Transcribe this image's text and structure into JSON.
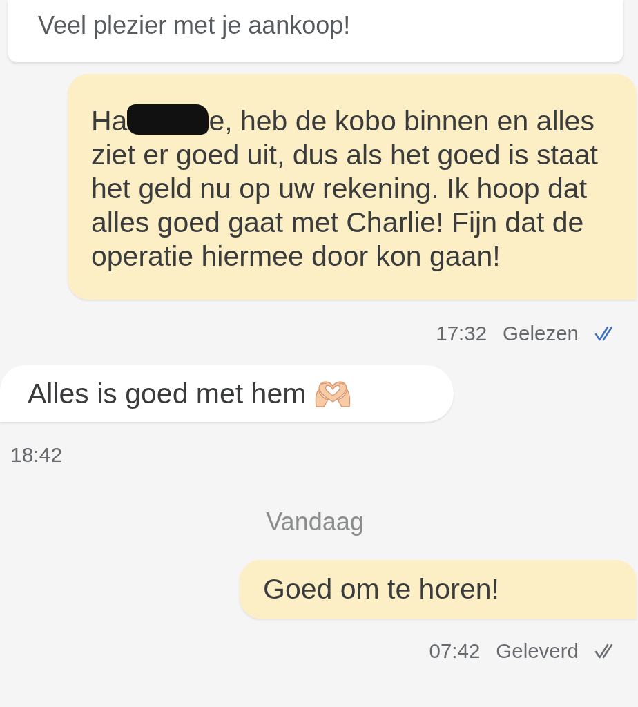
{
  "messages": [
    {
      "kind": "card",
      "text": "Veel plezier met je aankoop!"
    },
    {
      "kind": "outgoing",
      "segments": [
        {
          "kind": "text",
          "text": "Ha"
        },
        {
          "kind": "redaction"
        },
        {
          "kind": "text",
          "text": "e, heb de kobo binnen en alles ziet er goed uit, dus als het goed is staat het geld nu op uw rekening. Ik hoop dat alles goed gaat met Charlie! Fijn dat de operatie hiermee door kon gaan!"
        }
      ],
      "time": "17:32",
      "status": "Gelezen",
      "read": true
    },
    {
      "kind": "incoming",
      "text": "Alles is goed met hem",
      "emoji": true,
      "time": "18:42"
    },
    {
      "kind": "date",
      "text": "Vandaag"
    },
    {
      "kind": "outgoing",
      "text": "Goed om te horen!",
      "time": "07:42",
      "status": "Geleverd",
      "read": false
    }
  ]
}
